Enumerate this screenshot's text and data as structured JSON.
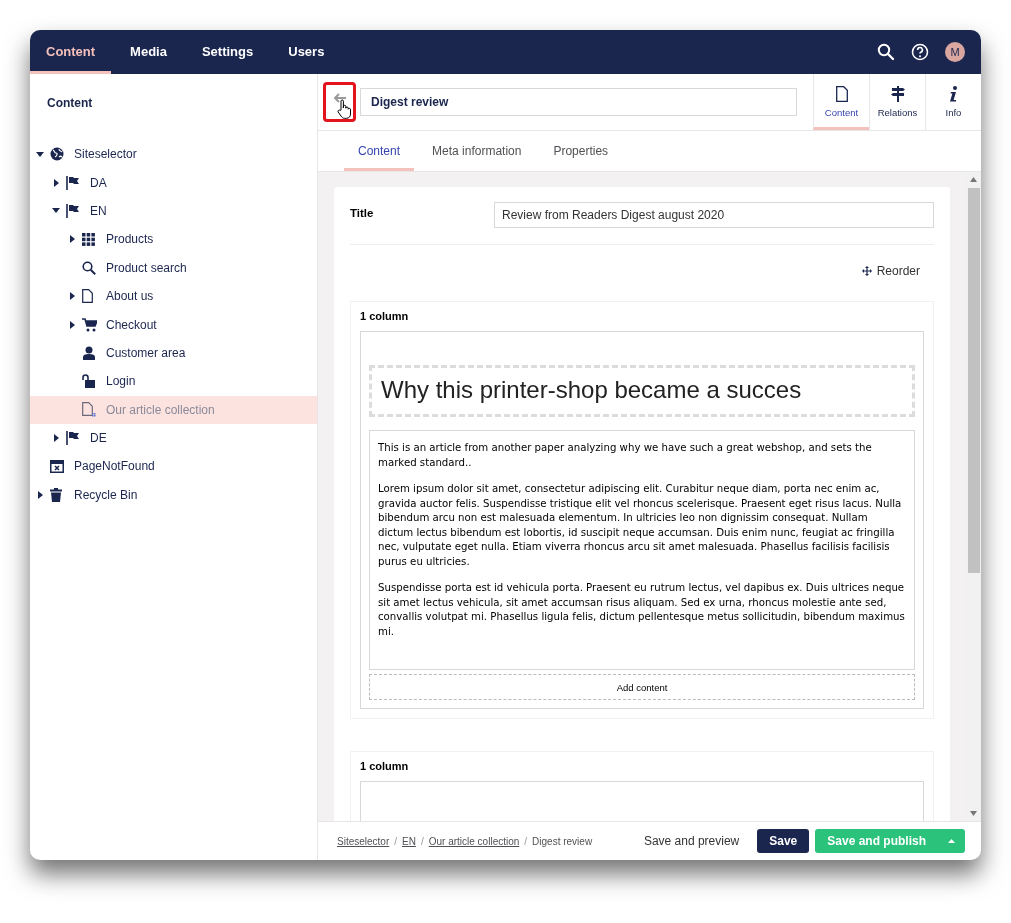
{
  "top_nav": {
    "sections": [
      {
        "label": "Content",
        "selected": true
      },
      {
        "label": "Media",
        "selected": false
      },
      {
        "label": "Settings",
        "selected": false
      },
      {
        "label": "Users",
        "selected": false
      }
    ],
    "avatar": "M"
  },
  "sidebar": {
    "title": "Content",
    "tree": [
      {
        "label": "Siteselector",
        "kind": "globe",
        "expanded": true,
        "selected": false,
        "children": [
          {
            "label": "DA",
            "kind": "flag",
            "expanded": false,
            "selected": false
          },
          {
            "label": "EN",
            "kind": "flag",
            "expanded": true,
            "selected": false,
            "children": [
              {
                "label": "Products",
                "kind": "grid",
                "expanded": false,
                "selected": false
              },
              {
                "label": "Product search",
                "kind": "search",
                "selected": false
              },
              {
                "label": "About us",
                "kind": "page",
                "expanded": false,
                "selected": false
              },
              {
                "label": "Checkout",
                "kind": "cart",
                "expanded": false,
                "selected": false
              },
              {
                "label": "Customer area",
                "kind": "user",
                "selected": false
              },
              {
                "label": "Login",
                "kind": "lock",
                "selected": false
              },
              {
                "label": "Our article collection",
                "kind": "page-grid",
                "selected": true
              }
            ]
          },
          {
            "label": "DE",
            "kind": "flag",
            "expanded": false,
            "selected": false
          }
        ]
      },
      {
        "label": "PageNotFound",
        "kind": "calendar-x",
        "selected": false
      },
      {
        "label": "Recycle Bin",
        "kind": "trash",
        "expanded": false,
        "selected": false
      }
    ]
  },
  "editor": {
    "back_button": {
      "highlighted": true
    },
    "name": "Digest review",
    "apps": [
      {
        "label": "Content",
        "kind": "page",
        "selected": true
      },
      {
        "label": "Relations",
        "kind": "signpost",
        "selected": false
      },
      {
        "label": "Info",
        "kind": "info",
        "selected": false
      }
    ],
    "tabs": [
      {
        "label": "Content",
        "selected": true
      },
      {
        "label": "Meta information",
        "selected": false
      },
      {
        "label": "Properties",
        "selected": false
      }
    ],
    "title_label": "Title",
    "title_value": "Review from Readers Digest august 2020",
    "reorder": "Reorder",
    "blocks": [
      {
        "label": "1 column",
        "heading": "Why this printer-shop became a succes",
        "paragraphs": [
          "This is an article from another paper analyzing why we have such a great webshop, and sets the marked standard..",
          "Lorem ipsum dolor sit amet, consectetur adipiscing elit. Curabitur neque diam, porta nec enim ac, gravida auctor felis. Suspendisse tristique elit vel rhoncus scelerisque. Praesent eget risus lacus. Nulla bibendum arcu non est malesuada elementum. In ultricies leo non dignissim consequat. Nullam dictum lectus bibendum est lobortis, id suscipit neque accumsan. Duis enim nunc, feugiat ac fringilla nec, vulputate eget nulla. Etiam viverra rhoncus arcu sit amet malesuada. Phasellus facilisis facilisis purus eu ultricies.",
          "Suspendisse porta est id vehicula porta. Praesent eu rutrum lectus, vel dapibus ex. Duis ultrices neque sit amet lectus vehicula, sit amet accumsan risus aliquam. Sed ex urna, rhoncus molestie ante sed, convallis volutpat mi. Phasellus ligula felis, dictum pellentesque metus sollicitudin, bibendum maximus mi."
        ],
        "add_content": "Add content"
      },
      {
        "label": "1 column"
      }
    ]
  },
  "footer": {
    "breadcrumb": [
      {
        "label": "Siteselector",
        "link": true
      },
      {
        "separator": "/",
        "label": "EN",
        "link": true
      },
      {
        "separator": "/",
        "label": "Our article collection",
        "link": true
      },
      {
        "separator": "/",
        "label": "Digest review",
        "link": false
      }
    ],
    "save_preview": "Save and preview",
    "save": "Save",
    "save_publish": "Save and publish"
  }
}
